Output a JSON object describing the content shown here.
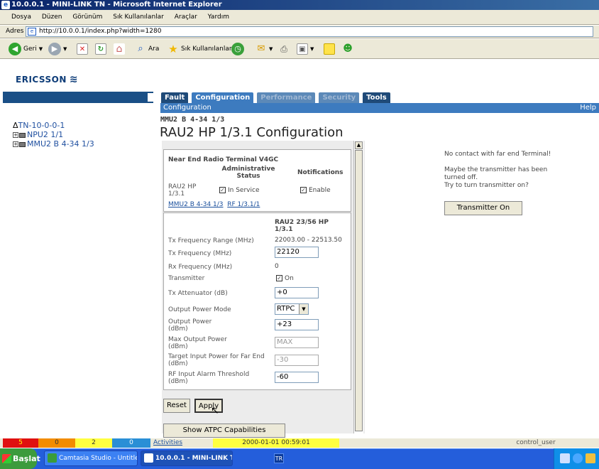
{
  "window": {
    "title": "10.0.0.1 - MINI-LINK TN - Microsoft Internet Explorer"
  },
  "menu": [
    "Dosya",
    "Düzen",
    "Görünüm",
    "Sık Kullanılanlar",
    "Araçlar",
    "Yardım"
  ],
  "address": {
    "label": "Adres",
    "url": "http://10.0.0.1/index.php?width=1280"
  },
  "toolbar": {
    "back": "Geri",
    "search": "Ara",
    "favorites": "Sık Kullanılanlar"
  },
  "logo": "ERICSSON",
  "tree": [
    "TN-10-0-0-1",
    "NPU2 1/1",
    "MMU2 B 4-34 1/3"
  ],
  "tabs": [
    "Fault",
    "Configuration",
    "Performance",
    "Security",
    "Tools"
  ],
  "subbar": {
    "section": "Configuration",
    "help": "Help"
  },
  "breadcrumb": "MMU2 B 4-34 1/3",
  "page_title": "RAU2 HP 1/3.1 Configuration",
  "near_end": {
    "heading": "Near End Radio Terminal V4GC",
    "col_admin": "Administrative Status",
    "col_notif": "Notifications",
    "row_label": "RAU2 HP 1/3.1",
    "admin_value": "In Service",
    "notif_value": "Enable",
    "link1": "MMU2 B 4-34 1/3",
    "link2": "RF 1/3.1/1"
  },
  "params": {
    "col_header": "RAU2 23/56 HP 1/3.1",
    "tx_range_label": "Tx Frequency Range (MHz)",
    "tx_range_value": "22003.00 - 22513.50",
    "tx_freq_label": "Tx Frequency (MHz)",
    "tx_freq_value": "22120",
    "rx_freq_label": "Rx Frequency (MHz)",
    "rx_freq_value": "0",
    "transmitter_label": "Transmitter",
    "transmitter_value": "On",
    "tx_att_label": "Tx Attenuator (dB)",
    "tx_att_value": "+0",
    "opm_label": "Output Power Mode",
    "opm_value": "RTPC",
    "op_label": "Output Power (dBm)",
    "op_value": "+23",
    "mop_label": "Max Output Power (dBm)",
    "mop_value": "MAX",
    "tip_label": "Target Input Power for Far End (dBm)",
    "tip_value": "-30",
    "rf_alarm_label": "RF Input Alarm Threshold (dBm)",
    "rf_alarm_value": "-60"
  },
  "buttons": {
    "reset": "Reset",
    "apply": "Apply",
    "atpc": "Show ATPC Capabilities",
    "transmitter_on": "Transmitter On"
  },
  "info": {
    "line1": "No contact with far end Terminal!",
    "line2": "Maybe the transmitter has been turned off.",
    "line3": "Try to turn transmitter on?"
  },
  "status": {
    "count_red": "5",
    "count_orange": "0",
    "count_yellow": "2",
    "count_blue": "0",
    "activities": "Activities",
    "datetime": "2000-01-01 00:59:01",
    "user": "control_user",
    "colors": {
      "red": "#e01010",
      "orange": "#f28c00",
      "yellow": "#ffff40",
      "blue": "#2a8fd6"
    }
  },
  "taskbar": {
    "start": "Başlat",
    "task1": "Camtasia Studio - Untitle...",
    "task2": "10.0.0.1 - MINI-LINK T...",
    "lang": "TR"
  }
}
